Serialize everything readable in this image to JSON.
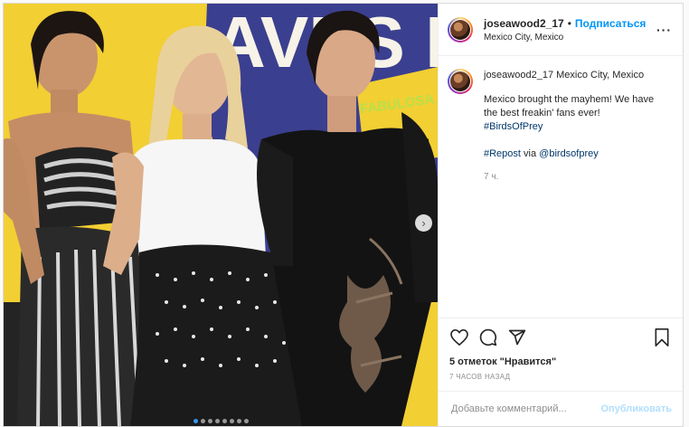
{
  "post": {
    "media": {
      "backdrop_letters": "AVES DE",
      "backdrop_small": "FABULOSA EMANCIPAC",
      "slide_count": 8,
      "active_slide": 1,
      "next_icon": "chevron-right-icon"
    },
    "header": {
      "username": "joseawood2_17",
      "separator": "•",
      "follow_label": "Подписаться",
      "location": "Mexico City, Mexico",
      "more_icon": "more-options-icon",
      "more_glyph": "···"
    },
    "caption": {
      "username": "joseawood2_17",
      "location": "Mexico City, Mexico",
      "line1": "Mexico brought the mayhem! We have the best freakin' fans ever!",
      "hashtag1": "#BirdsOfPrey",
      "repost_tag": "#Repost",
      "via": "via",
      "mention": "@birdsofprey",
      "time": "7 ч."
    },
    "actions": {
      "like_icon": "heart-icon",
      "comment_icon": "comment-icon",
      "share_icon": "paper-plane-icon",
      "save_icon": "bookmark-icon",
      "likes_text": "5 отметок \"Нравится\"",
      "time_ago": "7 ЧАСОВ НАЗАД"
    },
    "comment_box": {
      "placeholder": "Добавьте комментарий...",
      "publish_label": "Опубликовать"
    },
    "colors": {
      "accent": "#0095f6",
      "backdrop_yellow": "#f2cf33",
      "backdrop_blue": "#3b3f8f"
    }
  }
}
